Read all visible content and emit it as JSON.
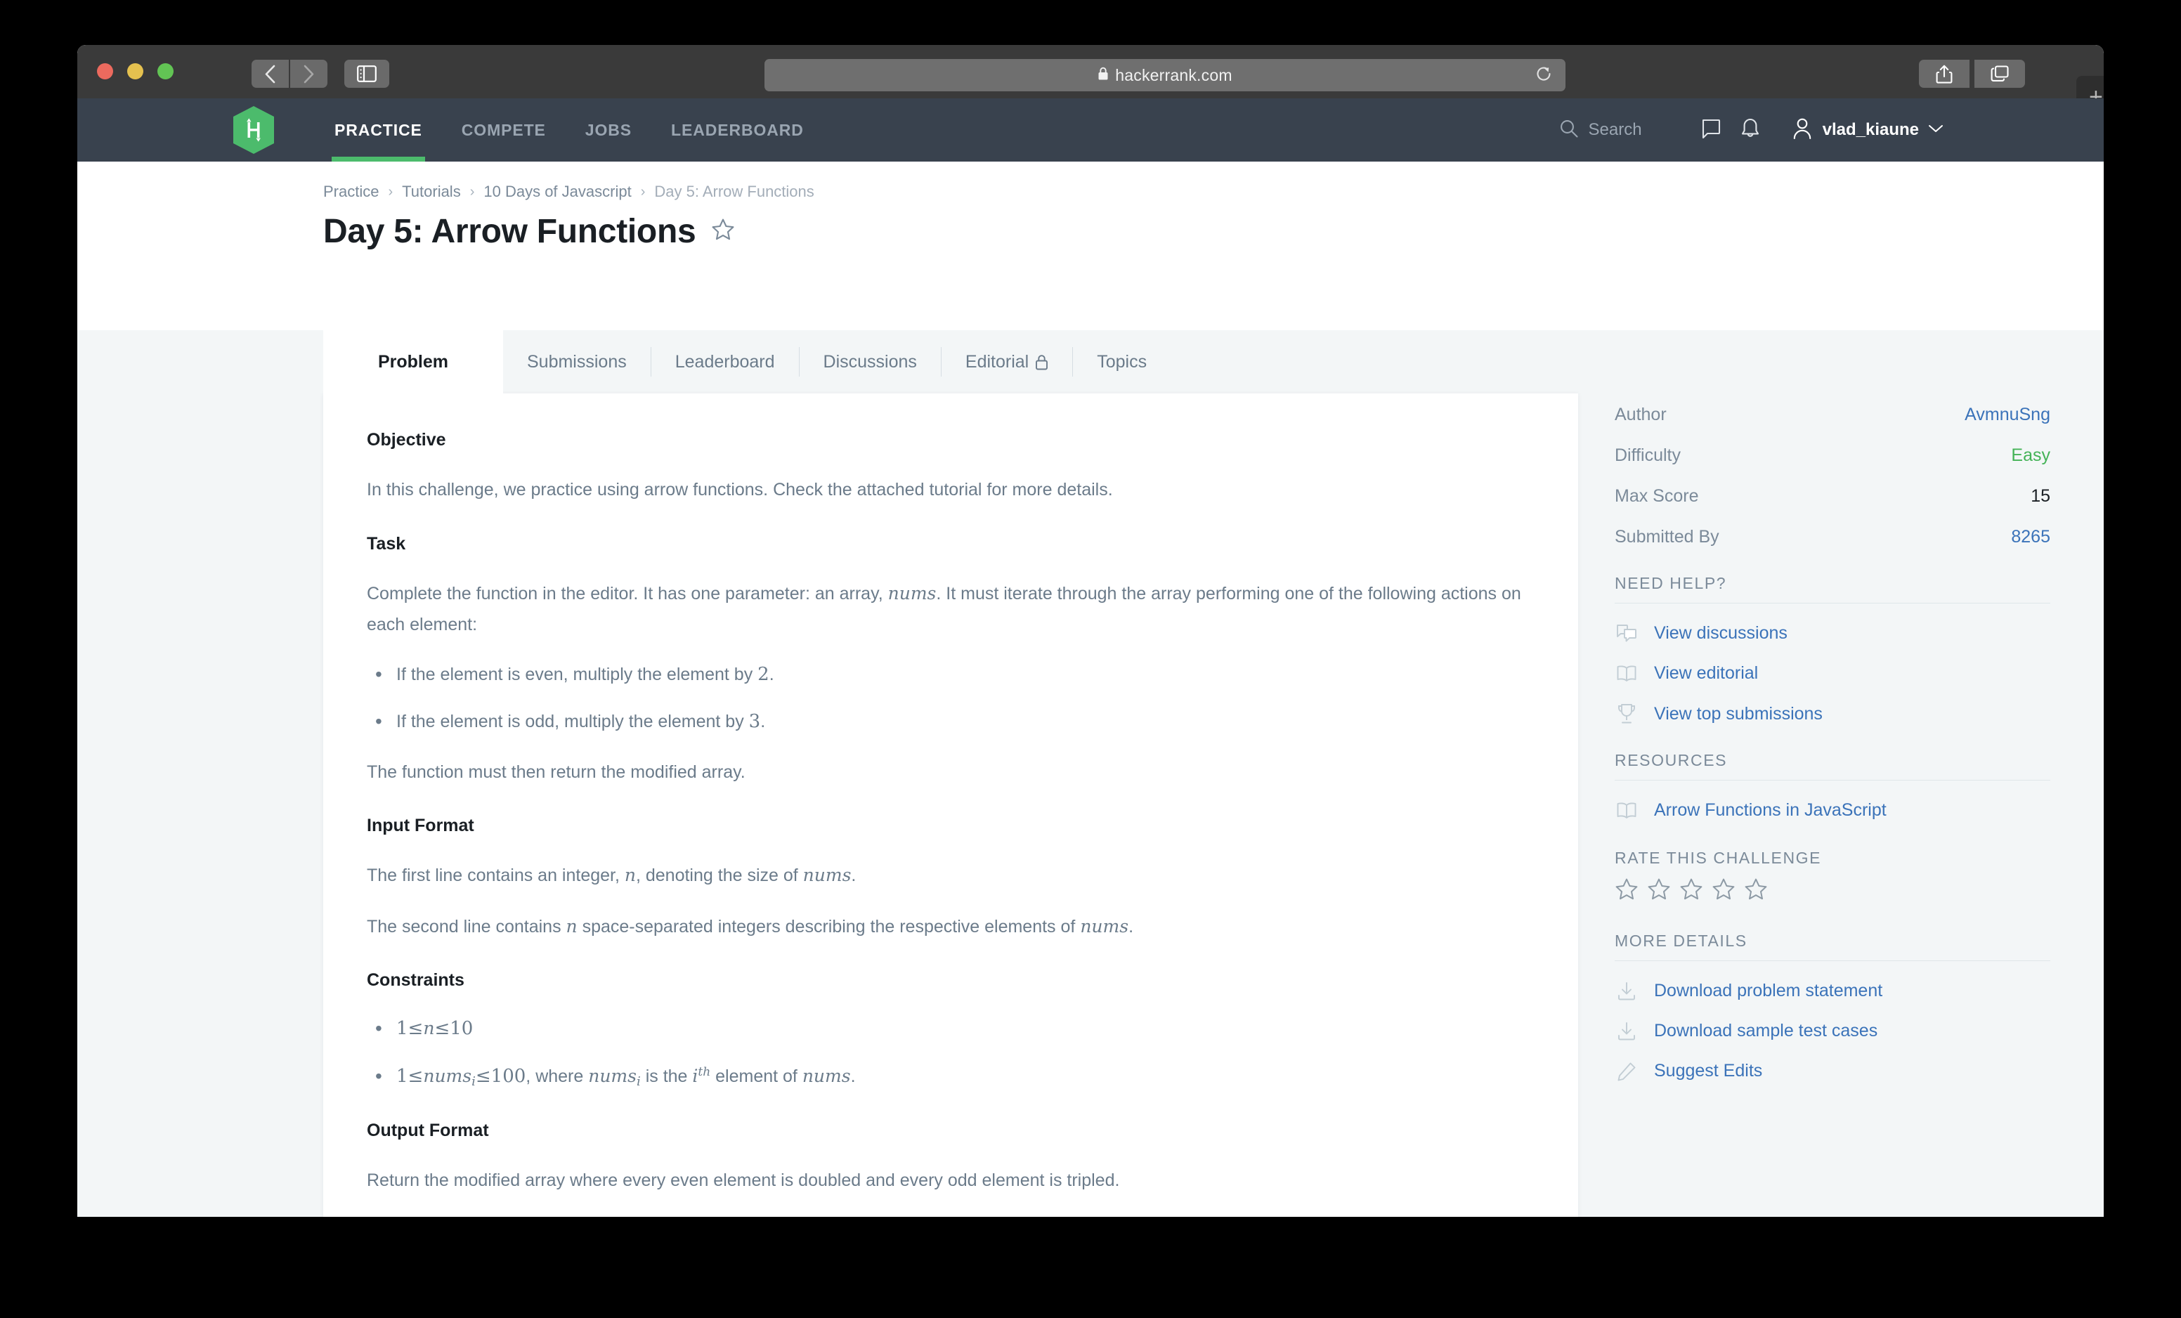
{
  "browser": {
    "url": "hackerrank.com",
    "lock_icon": "lock-icon",
    "back_icon": "chevron-left-icon",
    "forward_icon": "chevron-right-icon",
    "sidebar_icon": "sidebar-toggle-icon",
    "reload_icon": "reload-icon",
    "share_icon": "share-icon",
    "tabs_icon": "tab-overview-icon",
    "new_tab_label": "+"
  },
  "nav": {
    "logo_name": "hackerrank-logo",
    "links": [
      {
        "label": "PRACTICE",
        "active": true
      },
      {
        "label": "COMPETE",
        "active": false
      },
      {
        "label": "JOBS",
        "active": false
      },
      {
        "label": "LEADERBOARD",
        "active": false
      }
    ],
    "search_placeholder": "Search",
    "search_icon": "search-icon",
    "messages_icon": "chat-bubble-icon",
    "notifications_icon": "bell-icon",
    "user_icon": "user-avatar-icon",
    "user_name": "vlad_kiaune",
    "chevron_icon": "chevron-down-icon"
  },
  "header": {
    "breadcrumb": [
      "Practice",
      "Tutorials",
      "10 Days of Javascript",
      "Day 5: Arrow Functions"
    ],
    "breadcrumb_separator": "›",
    "title": "Day 5: Arrow Functions",
    "star_icon": "star-outline-icon"
  },
  "tabs": [
    {
      "label": "Problem",
      "active": true,
      "lock": false
    },
    {
      "label": "Submissions",
      "active": false,
      "lock": false
    },
    {
      "label": "Leaderboard",
      "active": false,
      "lock": false
    },
    {
      "label": "Discussions",
      "active": false,
      "lock": false
    },
    {
      "label": "Editorial",
      "active": false,
      "lock": true
    },
    {
      "label": "Topics",
      "active": false,
      "lock": false
    }
  ],
  "problem": {
    "objective_heading": "Objective",
    "objective_text": "In this challenge, we practice using arrow functions. Check the attached tutorial for more details.",
    "task_heading": "Task",
    "task_text_1": "Complete the function in the editor. It has one parameter: an array, ",
    "task_var": "nums",
    "task_text_2": ". It must iterate through the array performing one of the following actions on each element:",
    "bullet_even_pre": "If the element is even, multiply the element by ",
    "bullet_even_num": "2",
    "bullet_even_post": ".",
    "bullet_odd_pre": "If the element is odd, multiply the element by ",
    "bullet_odd_num": "3",
    "bullet_odd_post": ".",
    "task_return": "The function must then return the modified array.",
    "input_format_heading": "Input Format",
    "input_line_1_a": "The first line contains an integer, ",
    "input_line_1_n": "n",
    "input_line_1_b": ", denoting the size of ",
    "input_line_1_nums": "nums",
    "input_line_1_c": ".",
    "input_line_2_a": "The second line contains ",
    "input_line_2_n": "n",
    "input_line_2_b": " space-separated integers describing the respective elements of ",
    "input_line_2_nums": "nums",
    "input_line_2_c": ".",
    "constraints_heading": "Constraints",
    "constraint_1": {
      "low": "1",
      "le1": "≤",
      "var": "n",
      "le2": "≤",
      "high": "10"
    },
    "constraint_2": {
      "low": "1",
      "le1": "≤",
      "var": "nums",
      "sub": "i",
      "le2": "≤",
      "high": "100",
      "tail_a": ", where ",
      "tail_var": "nums",
      "tail_sub": "i",
      "tail_b": " is the ",
      "tail_i": "i",
      "tail_sup": "th",
      "tail_c": " element of ",
      "tail_nums": "nums",
      "tail_d": "."
    },
    "output_format_heading": "Output Format",
    "output_text": "Return the modified array where every even element is doubled and every odd element is tripled."
  },
  "sidebar": {
    "meta": [
      {
        "label": "Author",
        "value": "AvmnuSng",
        "style": "link"
      },
      {
        "label": "Difficulty",
        "value": "Easy",
        "style": "easy"
      },
      {
        "label": "Max Score",
        "value": "15",
        "style": "plain"
      },
      {
        "label": "Submitted By",
        "value": "8265",
        "style": "link"
      }
    ],
    "need_help_heading": "NEED HELP?",
    "need_help_links": [
      {
        "label": "View discussions",
        "icon": "discussions-icon"
      },
      {
        "label": "View editorial",
        "icon": "book-icon"
      },
      {
        "label": "View top submissions",
        "icon": "trophy-icon"
      }
    ],
    "resources_heading": "RESOURCES",
    "resources_links": [
      {
        "label": "Arrow Functions in JavaScript",
        "icon": "book-icon"
      }
    ],
    "rate_heading": "RATE THIS CHALLENGE",
    "rating_stars": 5,
    "rating_filled": 0,
    "star_icon": "star-outline-icon",
    "more_details_heading": "MORE DETAILS",
    "more_details_links": [
      {
        "label": "Download problem statement",
        "icon": "download-icon"
      },
      {
        "label": "Download sample test cases",
        "icon": "download-icon"
      },
      {
        "label": "Suggest Edits",
        "icon": "pencil-icon"
      }
    ]
  },
  "colors": {
    "nav_bg": "#39424e",
    "brand_green": "#4cbb6c",
    "link_blue": "#3b73b9",
    "easy_green": "#44b357",
    "page_bg": "#f3f6f7"
  }
}
